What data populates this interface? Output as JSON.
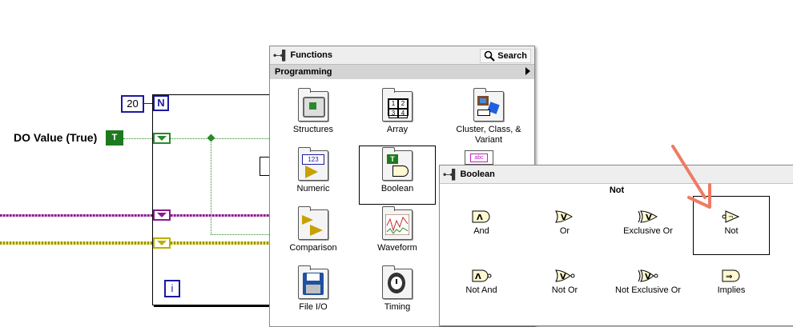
{
  "block_diagram": {
    "loop_count_value": "20",
    "loop_count_terminal": "N",
    "iteration_terminal": "i",
    "do_value_label": "DO Value (True)",
    "bool_constant_glyph": "T"
  },
  "functions_palette": {
    "title": "Functions",
    "search_label": "Search",
    "category": "Programming",
    "items": [
      {
        "label": "Structures",
        "icon": "structures-icon"
      },
      {
        "label": "Array",
        "icon": "array-icon"
      },
      {
        "label": "Cluster, Class, & Variant",
        "icon": "cluster-icon"
      },
      {
        "label": "Numeric",
        "icon": "numeric-icon"
      },
      {
        "label": "Boolean",
        "icon": "boolean-icon"
      },
      {
        "label": "Comparison",
        "icon": "comparison-icon"
      },
      {
        "label": "Waveform",
        "icon": "waveform-icon"
      },
      {
        "label": "File I/O",
        "icon": "file-io-icon"
      },
      {
        "label": "Timing",
        "icon": "timing-icon"
      }
    ],
    "array_icon_digits": [
      "1",
      "2",
      "3",
      "4"
    ],
    "numeric_icon_text": "123",
    "string_icon_text": "abc"
  },
  "boolean_palette": {
    "title": "Boolean",
    "hover_caption": "Not",
    "items": [
      {
        "label": "And",
        "glyph": "Λ"
      },
      {
        "label": "Or",
        "glyph": "V"
      },
      {
        "label": "Exclusive Or",
        "glyph": "V"
      },
      {
        "label": "Not",
        "glyph": "¬"
      },
      {
        "label": "Not And",
        "glyph": "Λ"
      },
      {
        "label": "Not Or",
        "glyph": "V"
      },
      {
        "label": "Not Exclusive Or",
        "glyph": "V"
      },
      {
        "label": "Implies",
        "glyph": "⇒"
      }
    ]
  },
  "colors": {
    "boolean_wire": "#2a8a2a",
    "loop_terminal": "#1a1aa0",
    "purple_wire": "#8b1a8b",
    "yellow_wire": "#b8b000",
    "annotation_arrow": "#f07a63"
  }
}
